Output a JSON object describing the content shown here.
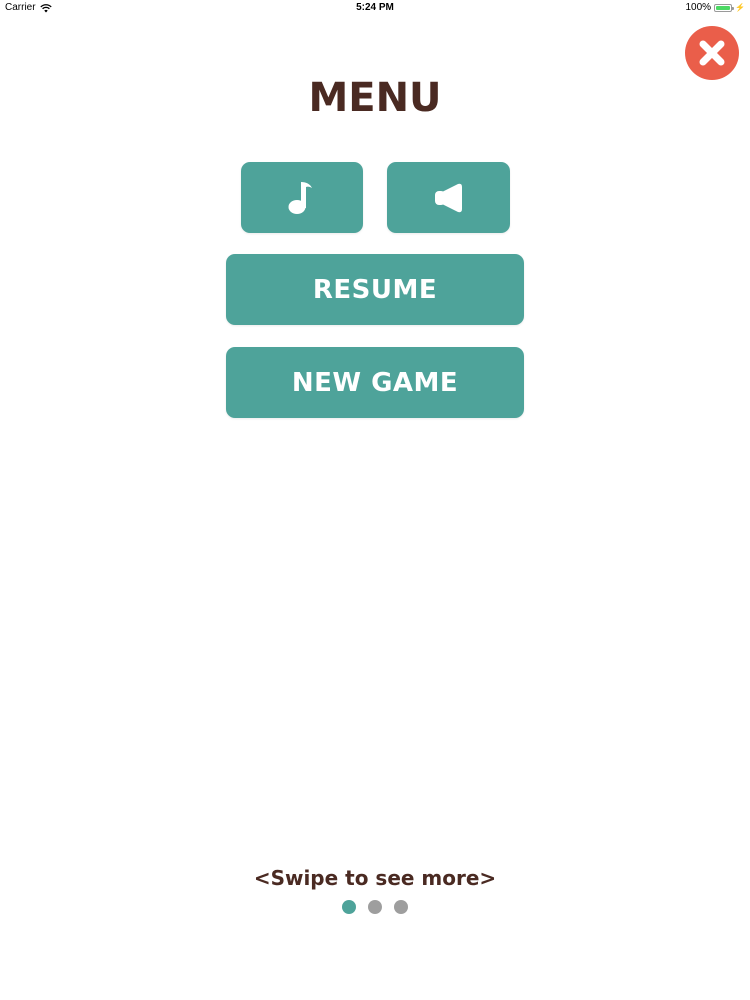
{
  "status_bar": {
    "carrier": "Carrier",
    "time": "5:24 PM",
    "battery": "100%",
    "battery_level": 1.0,
    "icons": [
      "wifi-icon",
      "battery-icon",
      "charging-bolt-icon"
    ]
  },
  "close_button": {
    "icon": "close-x-icon",
    "color": "#ea5e4a"
  },
  "menu": {
    "title": "MENU",
    "music_button": {
      "icon": "music-note-icon"
    },
    "sound_button": {
      "icon": "speaker-icon"
    },
    "resume_label": "RESUME",
    "new_game_label": "NEW GAME"
  },
  "footer": {
    "swipe_hint": "<Swipe to see more>",
    "pages": [
      {
        "active": true
      },
      {
        "active": false
      },
      {
        "active": false
      }
    ]
  },
  "colors": {
    "accent": "#4ea39a",
    "title_text": "#4a2a22",
    "close_red": "#ea5e4a",
    "inactive_dot": "#9e9e9e"
  }
}
